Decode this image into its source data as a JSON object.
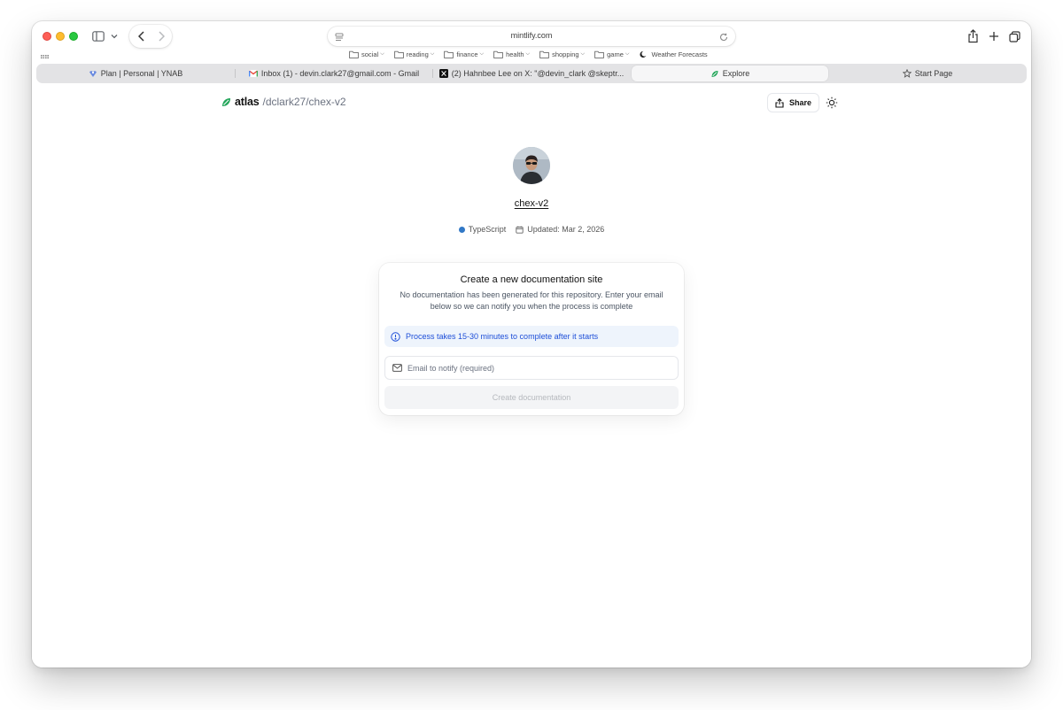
{
  "browser": {
    "url": "mintlify.com",
    "bookmarks": [
      {
        "label": "social",
        "folder": true
      },
      {
        "label": "reading",
        "folder": true
      },
      {
        "label": "finance",
        "folder": true
      },
      {
        "label": "health",
        "folder": true
      },
      {
        "label": "shopping",
        "folder": true
      },
      {
        "label": "game",
        "folder": true
      },
      {
        "label": "Weather Forecasts",
        "folder": false
      }
    ],
    "tabs": [
      {
        "label": "Plan | Personal | YNAB",
        "icon": "ynab-icon"
      },
      {
        "label": "Inbox (1) - devin.clark27@gmail.com - Gmail",
        "icon": "gmail-icon"
      },
      {
        "label": "(2) Hahnbee Lee on X: \"@devin_clark @skeptr...",
        "icon": "x-icon"
      },
      {
        "label": "Explore",
        "icon": "atlas-icon",
        "active": true
      },
      {
        "label": "Start Page",
        "icon": "star-icon"
      }
    ]
  },
  "header": {
    "brand": "atlas",
    "repo_path": "/dclark27/chex-v2",
    "share_label": "Share"
  },
  "repo": {
    "name": "chex-v2",
    "language": "TypeScript",
    "language_color": "#3178c6",
    "updated": "Updated: Mar 2, 2026"
  },
  "card": {
    "title": "Create a new documentation site",
    "description": "No documentation has been generated for this repository. Enter your email below so we can notify you when the process is complete",
    "info": "Process takes 15-30 minutes to complete after it starts",
    "email_placeholder": "Email to notify (required)",
    "email_value": "",
    "button_label": "Create documentation"
  },
  "colors": {
    "accent_blue": "#1d4ed8",
    "info_bg": "#eef4fc",
    "atlas_green": "#16a34a"
  }
}
